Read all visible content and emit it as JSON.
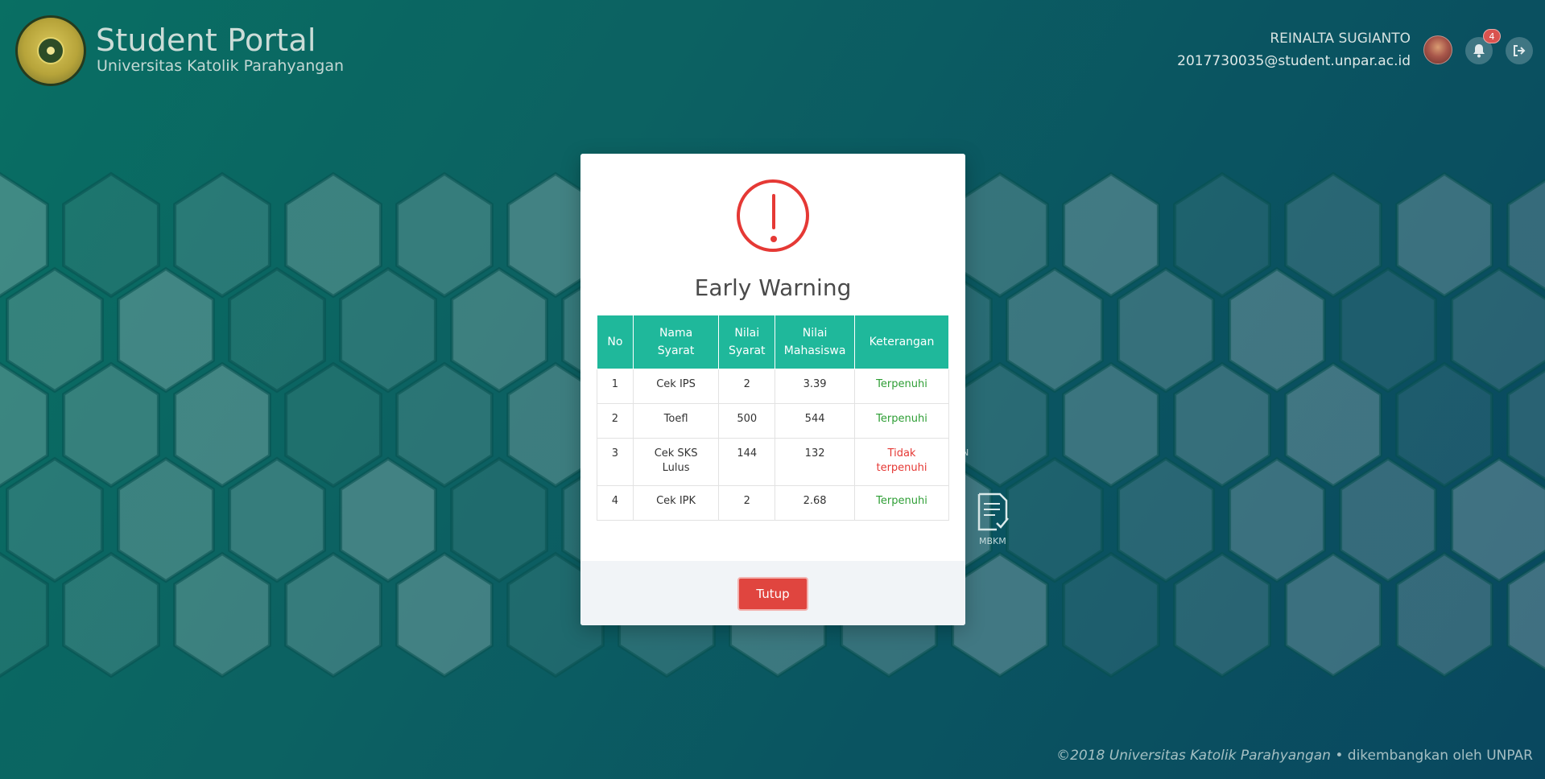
{
  "header": {
    "title": "Student Portal",
    "subtitle": "Universitas Katolik Parahyangan",
    "user_name": "REINALTA SUGIANTO",
    "user_email": "2017730035@student.unpar.ac.id",
    "notification_count": "4",
    "icons": {
      "logo": "university-seal-logo",
      "avatar": "user-avatar",
      "bell": "bell-icon",
      "logout": "logout-icon"
    }
  },
  "background": {
    "tiles": [
      {
        "label": "MBKM",
        "icon": "document-check-icon"
      },
      {
        "label": "N",
        "icon": ""
      }
    ]
  },
  "modal": {
    "icon": "exclamation-circle-icon",
    "title": "Early Warning",
    "table": {
      "headers": [
        "No",
        "Nama Syarat",
        "Nilai Syarat",
        "Nilai Mahasiswa",
        "Keterangan"
      ],
      "header_lines": [
        [
          "No"
        ],
        [
          "Nama",
          "Syarat"
        ],
        [
          "Nilai",
          "Syarat"
        ],
        [
          "Nilai",
          "Mahasiswa"
        ],
        [
          "Keterangan"
        ]
      ],
      "rows": [
        {
          "no": "1",
          "nama": "Cek IPS",
          "syarat": "2",
          "mahasiswa": "3.39",
          "keterangan": "Terpenuhi",
          "status": "ok"
        },
        {
          "no": "2",
          "nama": "Toefl",
          "syarat": "500",
          "mahasiswa": "544",
          "keterangan": "Terpenuhi",
          "status": "ok"
        },
        {
          "no": "3",
          "nama": "Cek SKS Lulus",
          "syarat": "144",
          "mahasiswa": "132",
          "keterangan": "Tidak terpenuhi",
          "status": "bad"
        },
        {
          "no": "4",
          "nama": "Cek IPK",
          "syarat": "2",
          "mahasiswa": "2.68",
          "keterangan": "Terpenuhi",
          "status": "ok"
        }
      ]
    },
    "close_label": "Tutup"
  },
  "footer": {
    "copyright": "©2018 Universitas Katolik Parahyangan",
    "separator": "•",
    "credit": "dikembangkan oleh UNPAR"
  },
  "colors": {
    "accent": "#1fb89b",
    "danger": "#e53935",
    "success": "#2e9e35",
    "button": "#e0453f"
  }
}
